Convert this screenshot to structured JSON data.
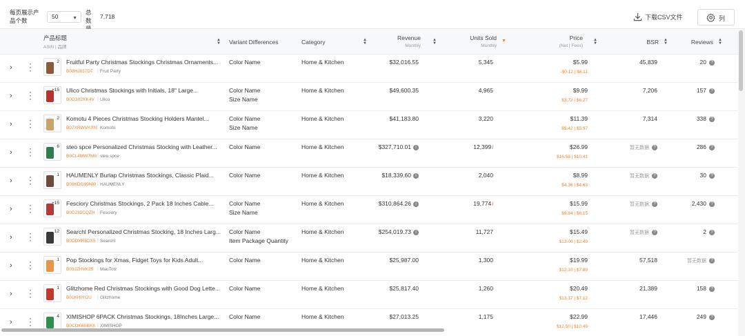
{
  "toolbar": {
    "per_page_label": "每页展示产品个数",
    "per_page_value": "50",
    "total_label": "总数量",
    "total_value": "7,718",
    "download_label": "下载CSV文件",
    "columns_label": "列"
  },
  "columns": {
    "title": "产品标题",
    "title_sub": "ASIN | 品牌",
    "variant": "Variant Differences",
    "category": "Category",
    "revenue": "Revenue",
    "revenue_sub": "Monthly",
    "units": "Units Sold",
    "units_sub": "Monthly",
    "price": "Price",
    "price_sub": "(Net | Fees)",
    "bsr": "BSR",
    "reviews": "Reviews"
  },
  "no_data_label": "暂无数据",
  "rows": [
    {
      "count": "2",
      "title": "Fruitful Party Christmas Stockings Christmas Ornaments...",
      "asin": "B08HJ817DT",
      "brand": "Fruit Party",
      "variants": [
        "Color Name"
      ],
      "category": "Home & Kitchen",
      "revenue": "$32,016.55",
      "revenue_info": false,
      "units": "5,345",
      "units_flag": false,
      "price": "$5.99",
      "price_sub": "-$0.12 | $6.11",
      "bsr": "45,839",
      "reviews": "20"
    },
    {
      "count": "+15",
      "title": "Ulico Christmas Stockings with Initials, 18\" Large...",
      "asin": "B0D3X2KK4V",
      "brand": "Ulico",
      "variants": [
        "Color Name",
        "Size Name"
      ],
      "category": "Home & Kitchen",
      "revenue": "$49,600.35",
      "revenue_info": false,
      "units": "4,965",
      "units_flag": false,
      "price": "$9.99",
      "price_sub": "$3.72 | $6.27",
      "bsr": "7,206",
      "reviews": "157"
    },
    {
      "count": "2",
      "title": "Komotu 4 Pieces Christmas Stocking Holders Mantel...",
      "asin": "B07XRWVKXN",
      "brand": "Komotu",
      "variants": [
        "Color Name",
        "Size Name"
      ],
      "category": "Home & Kitchen",
      "revenue": "$41,183.80",
      "revenue_info": false,
      "units": "3,220",
      "units_flag": false,
      "price": "$11.39",
      "price_sub": "$5.42 | $5.97",
      "bsr": "7,314",
      "reviews": "338"
    },
    {
      "count": "6",
      "title": "steo spce Personalized Christmas Stocking with Leather...",
      "asin": "B0CL4MW7M8",
      "brand": "steo spce",
      "variants": [
        "Color Name"
      ],
      "category": "Home & Kitchen",
      "revenue": "$327,710.01",
      "revenue_info": true,
      "units": "12,399",
      "units_flag": true,
      "price": "$26.99",
      "price_sub": "$16.58 | $10.41",
      "bsr": "",
      "reviews": "286"
    },
    {
      "count": "1",
      "title": "HAUMENLY Burlap Christmas Stockings, Classic Plaid...",
      "asin": "B08KDG99NM",
      "brand": "HAUMENLY",
      "variants": [
        "Color Name"
      ],
      "category": "Home & Kitchen",
      "revenue": "$18,339.60",
      "revenue_info": true,
      "units": "2,040",
      "units_flag": false,
      "price": "$8.99",
      "price_sub": "$4.36 | $4.63",
      "bsr": "",
      "reviews": "30"
    },
    {
      "count": "+15",
      "title": "Fesciory Christmas Stockings, 2 Pack 18 Inches Cable...",
      "asin": "B0DJ32CQZH",
      "brand": "Fesciory",
      "variants": [
        "Color Name",
        "Size Name"
      ],
      "category": "Home & Kitchen",
      "revenue": "$310,864.26",
      "revenue_info": true,
      "units": "19,774",
      "units_flag": true,
      "price": "$15.99",
      "price_sub": "$9.84 | $6.15",
      "bsr": "",
      "reviews": "2,430"
    },
    {
      "count": "12",
      "title": "Searchl Personalized Christmas Stocking, 18 Inches Larg...",
      "asin": "B0DDXR5DX5",
      "brand": "Searchl",
      "variants": [
        "Color Name",
        "Item Package Quantity"
      ],
      "category": "Home & Kitchen",
      "revenue": "$254,019.73",
      "revenue_info": true,
      "units": "11,727",
      "units_flag": false,
      "price": "$15.49",
      "price_sub": "$13.00 | $2.49",
      "bsr": "",
      "reviews": "2"
    },
    {
      "count": "1",
      "title": "Pop Stockings for Xmas, Fidget Toys for Kids Adult...",
      "asin": "B09JZHVK25",
      "brand": "MauTolz",
      "variants": [
        "Color Name"
      ],
      "category": "Home & Kitchen",
      "revenue": "$25,987.00",
      "revenue_info": false,
      "units": "1,300",
      "units_flag": false,
      "price": "$19.99",
      "price_sub": "$12.10 | $7.89",
      "bsr": "57,518",
      "reviews": ""
    },
    {
      "count": "1",
      "title": "Glitzhome Red Christmas Stockings with Good Dog Lette...",
      "asin": "B01KHIYI2U",
      "brand": "Glitzhome",
      "variants": [
        "Color Name"
      ],
      "category": "Home & Kitchen",
      "revenue": "$25,817.40",
      "revenue_info": false,
      "units": "1,260",
      "units_flag": false,
      "price": "$20.49",
      "price_sub": "$13.37 | $7.12",
      "bsr": "21,389",
      "reviews": "158"
    },
    {
      "count": "4",
      "title": "XIMISHOP 6PACK Christmas Stockings, 18Inches Large...",
      "asin": "B0CDK6SBK6",
      "brand": "XIMISHOP",
      "variants": [
        "Color Name"
      ],
      "category": "Home & Kitchen",
      "revenue": "$27,013.25",
      "revenue_info": false,
      "units": "1,175",
      "units_flag": false,
      "price": "$22.99",
      "price_sub": "$12.50 | $10.49",
      "bsr": "17,446",
      "reviews": "249"
    }
  ],
  "thumb_colors": [
    "#8a5a3c",
    "#b8312f",
    "#c9a36a",
    "#2e7d4f",
    "#6d4c3d",
    "#b23a3a",
    "#3a3a3a",
    "#e8954a",
    "#c0392b",
    "#2f8f4e"
  ]
}
